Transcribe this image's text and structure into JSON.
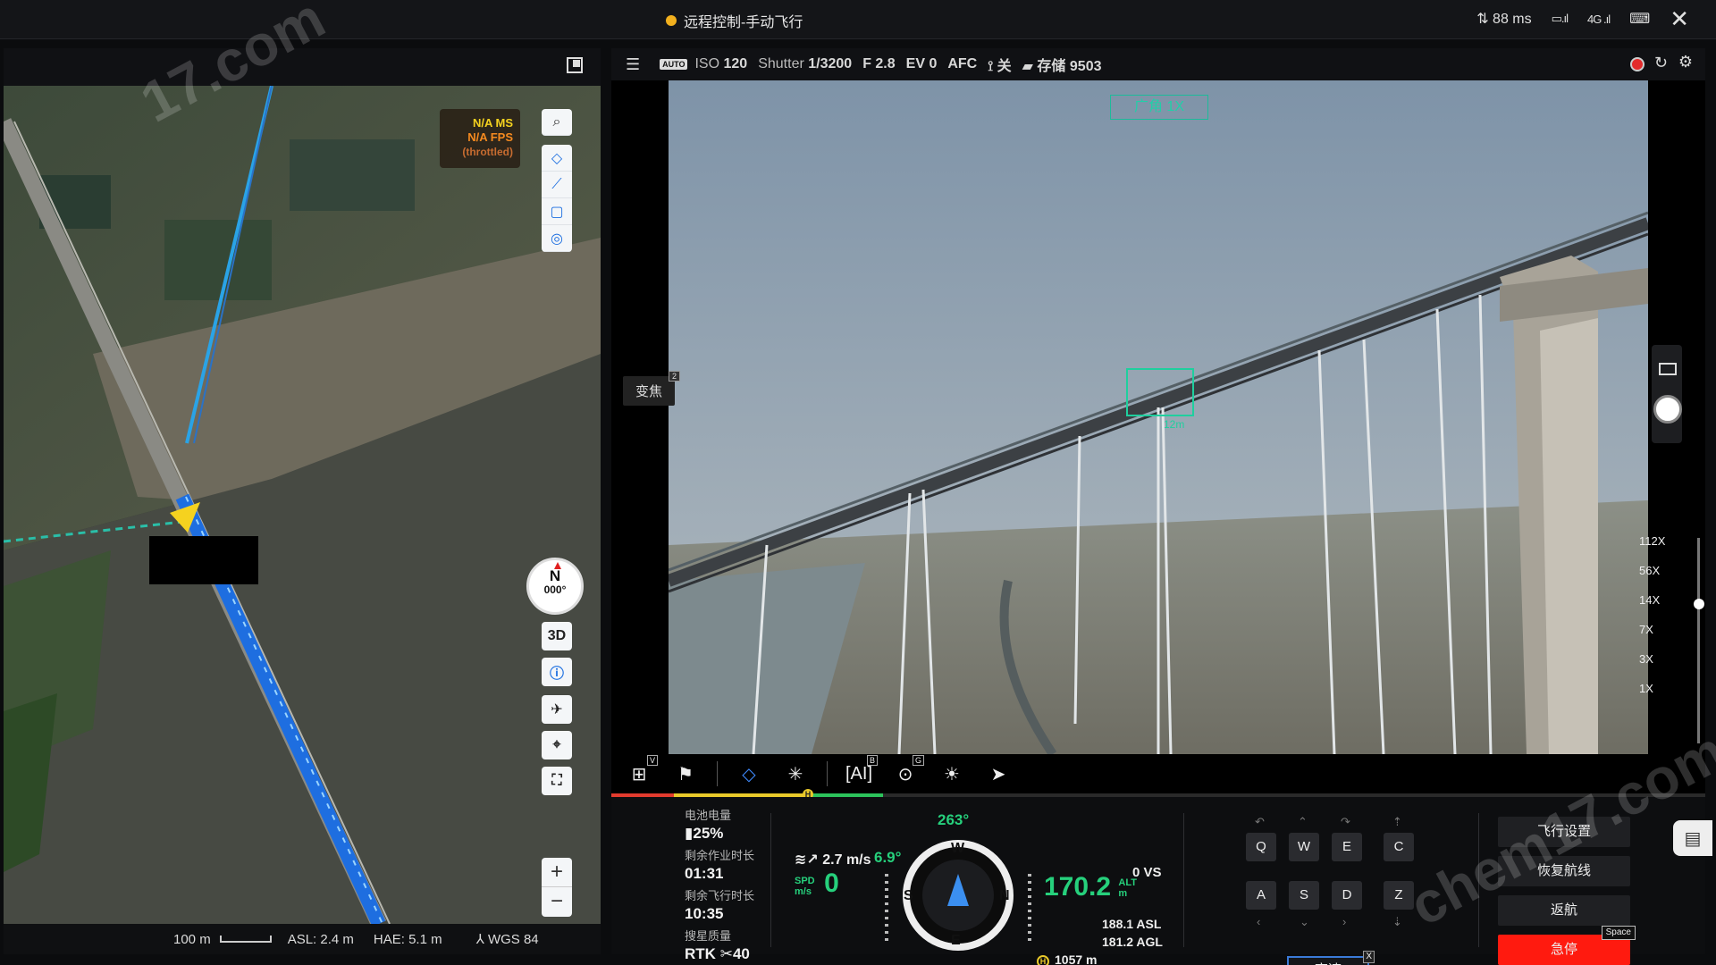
{
  "titlebar": {
    "title": "远程控制-手动飞行",
    "latency": "88 ms",
    "network": "4G"
  },
  "map": {
    "perf": {
      "ms": "N/A MS",
      "fps": "N/A FPS",
      "throttled": "(throttled)"
    },
    "compass": {
      "north": "N",
      "heading": "000°"
    },
    "view_3d": "3D",
    "footer": {
      "scale": "100 m",
      "asl": "ASL: 2.4 m",
      "hae": "HAE: 5.1 m",
      "datum": "WGS 84"
    }
  },
  "camera": {
    "params": {
      "iso_label": "ISO",
      "iso": "120",
      "shutter_label": "Shutter",
      "shutter": "1/3200",
      "f": "F 2.8",
      "ev": "EV 0",
      "focus": "AFC",
      "dewarp": "关",
      "storage_label": "存储",
      "storage": "9503"
    },
    "lens": "广角 1X",
    "zoom_button": "变焦",
    "zoom_button_key": "2",
    "target_label": "12m",
    "zoom_levels": [
      "112X",
      "56X",
      "14X",
      "7X",
      "3X",
      "1X"
    ],
    "tool_keys": {
      "grid": "V",
      "ai": "B",
      "target": "G"
    }
  },
  "telemetry": {
    "battery_label": "电池电量",
    "battery": "25%",
    "remaining_work_label": "剩余作业时长",
    "remaining_work": "01:31",
    "remaining_flight_label": "剩余飞行时长",
    "remaining_flight": "10:35",
    "gps_label": "搜星质量",
    "gps": "RTK",
    "gps_count": "40",
    "wind": "2.7 m/s",
    "spd_label_1": "SPD",
    "spd_label_2": "m/s",
    "speed": "0",
    "pitch": "6.9°",
    "heading": "263°",
    "compass_w": "W",
    "compass_s": "S",
    "compass_n": "N",
    "compass_e": "E",
    "altitude": "170.2",
    "alt_label_1": "ALT",
    "alt_label_2": "m",
    "vs": "0 VS",
    "asl": "188.1 ASL",
    "agl": "181.2 AGL",
    "home_icon": "H",
    "home_distance": "1057 m"
  },
  "keys": [
    "Q",
    "W",
    "E",
    "C",
    "A",
    "S",
    "D",
    "Z"
  ],
  "high_speed": "高速",
  "high_speed_key": "X",
  "actions": {
    "flight_settings": "飞行设置",
    "resume_route": "恢复航线",
    "return_home": "返航",
    "emergency_stop": "急停",
    "stop_key": "Space"
  },
  "colors": {
    "accent_green": "#26d07c",
    "stop_red": "#ff1a0f",
    "route_blue": "#1e90ff"
  }
}
